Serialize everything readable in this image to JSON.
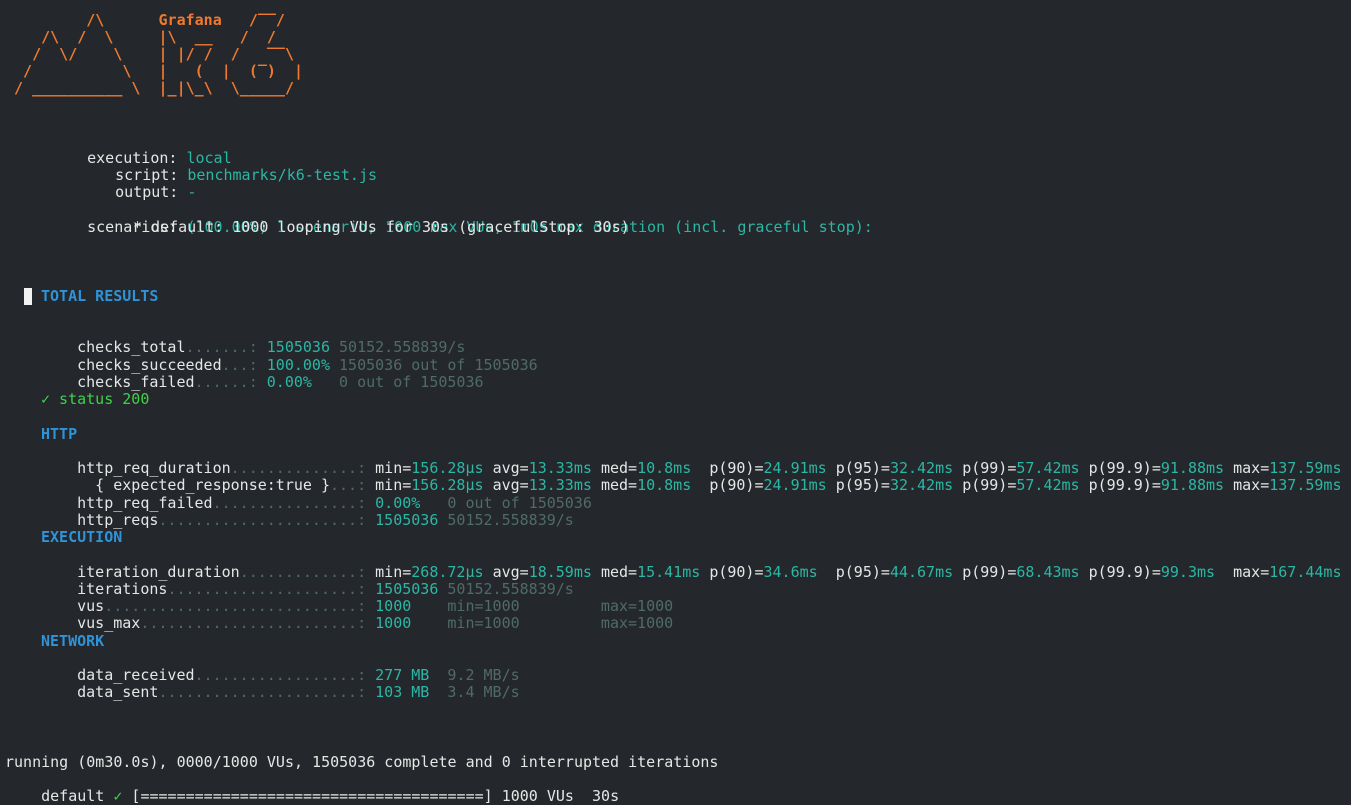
{
  "logo": {
    "lines": [
      "         /\\      Grafana   /‾‾/",
      "    /\\  /  \\     |\\  __   /  /",
      "   /  \\/    \\    | |/ /  /   ‾‾\\",
      "  /          \\   |   (  |  (‾)  |",
      " / __________ \\  |_|\\_\\  \\_____/"
    ]
  },
  "options": {
    "execution": {
      "key": "execution:",
      "value": "local"
    },
    "script": {
      "key": "script:",
      "value": "benchmarks/k6-test.js"
    },
    "output": {
      "key": "output:",
      "value": "-"
    },
    "scenarios": {
      "key": "scenarios:",
      "value": "(100.00%) 1 scenario, 1000 max VUs, 1m0s max duration (incl. graceful stop):"
    },
    "scenario_default": "* default: 1000 looping VUs for 30s (gracefulStop: 30s)"
  },
  "results": {
    "title": "TOTAL RESULTS",
    "checks": [
      {
        "name": "checks_total",
        "dots": ".......: ",
        "value": "1505036",
        "rest": " 50152.558839/s"
      },
      {
        "name": "checks_succeeded",
        "dots": "...: ",
        "value": "100.00%",
        "rest": " 1505036 out of 1505036"
      },
      {
        "name": "checks_failed",
        "dots": "......: ",
        "value": "0.00%",
        "rest": "   0 out of 1505036"
      }
    ],
    "check_status": "✓ status 200",
    "http": {
      "heading": "HTTP",
      "duration_row": {
        "name": "http_req_duration",
        "dots": "..............: "
      },
      "expected_row": {
        "name": "  { expected_response:true }",
        "dots": "...: "
      },
      "trend": [
        {
          "k": "min=",
          "v": "156.28µs",
          "sp": " "
        },
        {
          "k": "avg=",
          "v": "13.33ms",
          "sp": " "
        },
        {
          "k": "med=",
          "v": "10.8ms",
          "sp": "  "
        },
        {
          "k": "p(90)=",
          "v": "24.91ms",
          "sp": " "
        },
        {
          "k": "p(95)=",
          "v": "32.42ms",
          "sp": " "
        },
        {
          "k": "p(99)=",
          "v": "57.42ms",
          "sp": " "
        },
        {
          "k": "p(99.9)=",
          "v": "91.88ms",
          "sp": " "
        },
        {
          "k": "max=",
          "v": "137.59ms",
          "sp": ""
        }
      ],
      "failed": {
        "name": "http_req_failed",
        "dots": "................: ",
        "value": "0.00%",
        "rest": "   0 out of 1505036"
      },
      "reqs": {
        "name": "http_reqs",
        "dots": "......................: ",
        "value": "1505036",
        "rest": " 50152.558839/s"
      }
    },
    "execution": {
      "heading": "EXECUTION",
      "iteration_duration": {
        "name": "iteration_duration",
        "dots": ".............: "
      },
      "iter_trend": [
        {
          "k": "min=",
          "v": "268.72µs",
          "sp": " "
        },
        {
          "k": "avg=",
          "v": "18.59ms",
          "sp": " "
        },
        {
          "k": "med=",
          "v": "15.41ms",
          "sp": " "
        },
        {
          "k": "p(90)=",
          "v": "34.6ms",
          "sp": "  "
        },
        {
          "k": "p(95)=",
          "v": "44.67ms",
          "sp": " "
        },
        {
          "k": "p(99)=",
          "v": "68.43ms",
          "sp": " "
        },
        {
          "k": "p(99.9)=",
          "v": "99.3ms",
          "sp": "  "
        },
        {
          "k": "max=",
          "v": "167.44ms",
          "sp": ""
        }
      ],
      "iterations": {
        "name": "iterations",
        "dots": ".....................: ",
        "value": "1505036",
        "rest": " 50152.558839/s"
      },
      "vus": {
        "name": "vus",
        "dots": "............................: ",
        "value": "1000",
        "rest": "    min=1000         max=1000"
      },
      "vus_max": {
        "name": "vus_max",
        "dots": "........................: ",
        "value": "1000",
        "rest": "    min=1000         max=1000"
      }
    },
    "network": {
      "heading": "NETWORK",
      "data_received": {
        "name": "data_received",
        "dots": "..................: ",
        "value": "277 MB",
        "rest": "  9.2 MB/s"
      },
      "data_sent": {
        "name": "data_sent",
        "dots": "......................: ",
        "value": "103 MB",
        "rest": "  3.4 MB/s"
      }
    }
  },
  "footer": {
    "running": "running (0m30.0s), 0000/1000 VUs, 1505036 complete and 0 interrupted iterations",
    "scenario_name": "default ",
    "check_mark": "✓",
    "progress_bar": " [======================================] ",
    "summary": "1000 VUs  30s"
  },
  "colors": {
    "background": "#24272b",
    "logo": "#ef7a2f",
    "value": "#2bb7a5",
    "dim": "#4f6b68",
    "heading": "#2f93d8",
    "check": "#3fd14a"
  }
}
